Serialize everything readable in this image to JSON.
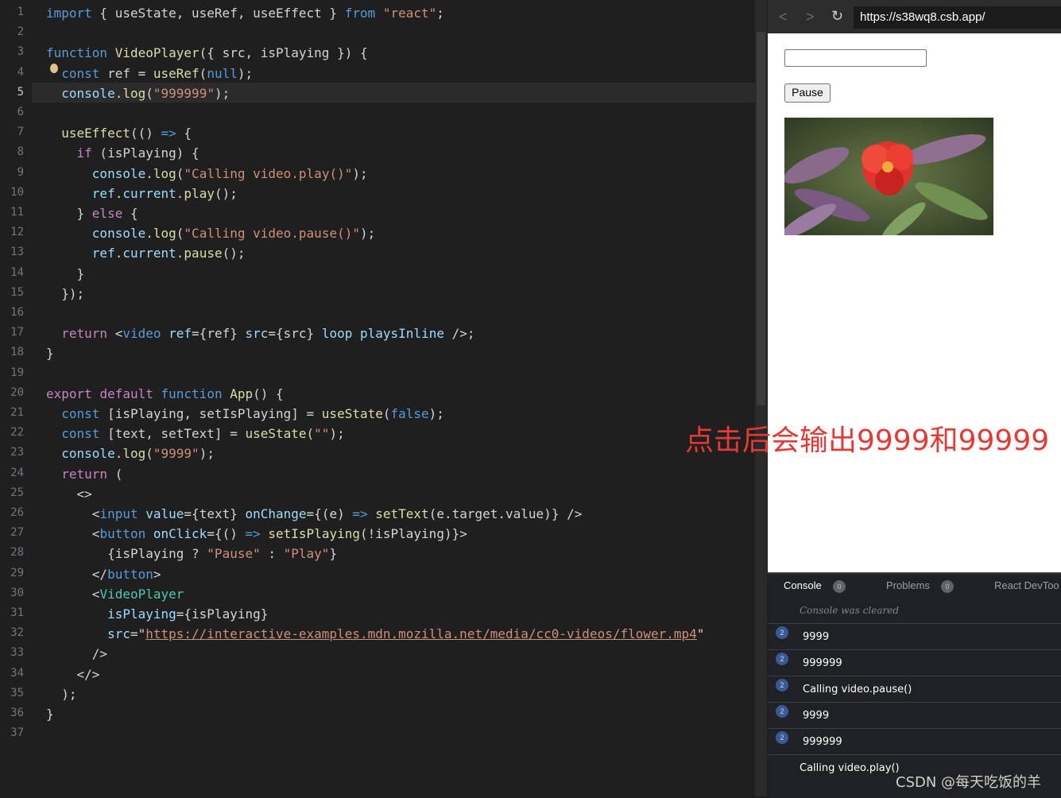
{
  "editor": {
    "line_numbers": [
      "1",
      "2",
      "3",
      "4",
      "5",
      "6",
      "7",
      "8",
      "9",
      "10",
      "11",
      "12",
      "13",
      "14",
      "15",
      "16",
      "17",
      "18",
      "19",
      "20",
      "21",
      "22",
      "23",
      "24",
      "25",
      "26",
      "27",
      "28",
      "29",
      "30",
      "31",
      "32",
      "33",
      "34",
      "35",
      "36",
      "37"
    ],
    "active_line": "5",
    "lines": [
      [
        [
          "kw",
          "import"
        ],
        [
          "pl",
          " { useState, useRef, useEffect } "
        ],
        [
          "kw",
          "from"
        ],
        [
          "pl",
          " "
        ],
        [
          "st",
          "\"react\""
        ],
        [
          "pl",
          ";"
        ]
      ],
      [],
      [
        [
          "kw",
          "function"
        ],
        [
          "pl",
          " "
        ],
        [
          "fn",
          "VideoPlayer"
        ],
        [
          "pl",
          "({ src, isPlaying }) {"
        ]
      ],
      [
        [
          "pl",
          "  "
        ],
        [
          "kw",
          "const"
        ],
        [
          "pl",
          " ref = "
        ],
        [
          "fn",
          "useRef"
        ],
        [
          "pl",
          "("
        ],
        [
          "kw",
          "null"
        ],
        [
          "pl",
          ");"
        ]
      ],
      [
        [
          "pl",
          "  "
        ],
        [
          "var",
          "console"
        ],
        [
          "pl",
          "."
        ],
        [
          "fn",
          "log"
        ],
        [
          "pl",
          "("
        ],
        [
          "st",
          "\"999999\""
        ],
        [
          "pl",
          ");"
        ]
      ],
      [],
      [
        [
          "pl",
          "  "
        ],
        [
          "fn",
          "useEffect"
        ],
        [
          "pl",
          "(() "
        ],
        [
          "kw",
          "=>"
        ],
        [
          "pl",
          " {"
        ]
      ],
      [
        [
          "pl",
          "    "
        ],
        [
          "ctl",
          "if"
        ],
        [
          "pl",
          " (isPlaying) {"
        ]
      ],
      [
        [
          "pl",
          "      "
        ],
        [
          "var",
          "console"
        ],
        [
          "pl",
          "."
        ],
        [
          "fn",
          "log"
        ],
        [
          "pl",
          "("
        ],
        [
          "st",
          "\"Calling video.play()\""
        ],
        [
          "pl",
          ");"
        ]
      ],
      [
        [
          "pl",
          "      "
        ],
        [
          "var",
          "ref"
        ],
        [
          "pl",
          "."
        ],
        [
          "var",
          "current"
        ],
        [
          "pl",
          "."
        ],
        [
          "fn",
          "play"
        ],
        [
          "pl",
          "();"
        ]
      ],
      [
        [
          "pl",
          "    } "
        ],
        [
          "ctl",
          "else"
        ],
        [
          "pl",
          " {"
        ]
      ],
      [
        [
          "pl",
          "      "
        ],
        [
          "var",
          "console"
        ],
        [
          "pl",
          "."
        ],
        [
          "fn",
          "log"
        ],
        [
          "pl",
          "("
        ],
        [
          "st",
          "\"Calling video.pause()\""
        ],
        [
          "pl",
          ");"
        ]
      ],
      [
        [
          "pl",
          "      "
        ],
        [
          "var",
          "ref"
        ],
        [
          "pl",
          "."
        ],
        [
          "var",
          "current"
        ],
        [
          "pl",
          "."
        ],
        [
          "fn",
          "pause"
        ],
        [
          "pl",
          "();"
        ]
      ],
      [
        [
          "pl",
          "    }"
        ]
      ],
      [
        [
          "pl",
          "  });"
        ]
      ],
      [],
      [
        [
          "pl",
          "  "
        ],
        [
          "ctl",
          "return"
        ],
        [
          "pl",
          " <"
        ],
        [
          "tag",
          "video"
        ],
        [
          "pl",
          " "
        ],
        [
          "attr",
          "ref"
        ],
        [
          "pl",
          "={ref} "
        ],
        [
          "attr",
          "src"
        ],
        [
          "pl",
          "={src} "
        ],
        [
          "attr",
          "loop"
        ],
        [
          "pl",
          " "
        ],
        [
          "attr",
          "playsInline"
        ],
        [
          "pl",
          " />;"
        ]
      ],
      [
        [
          "pl",
          "}"
        ]
      ],
      [],
      [
        [
          "ctl",
          "export"
        ],
        [
          "pl",
          " "
        ],
        [
          "ctl",
          "default"
        ],
        [
          "pl",
          " "
        ],
        [
          "kw",
          "function"
        ],
        [
          "pl",
          " "
        ],
        [
          "fn",
          "App"
        ],
        [
          "pl",
          "() {"
        ]
      ],
      [
        [
          "pl",
          "  "
        ],
        [
          "kw",
          "const"
        ],
        [
          "pl",
          " [isPlaying, setIsPlaying] = "
        ],
        [
          "fn",
          "useState"
        ],
        [
          "pl",
          "("
        ],
        [
          "kw",
          "false"
        ],
        [
          "pl",
          ");"
        ]
      ],
      [
        [
          "pl",
          "  "
        ],
        [
          "kw",
          "const"
        ],
        [
          "pl",
          " [text, setText] = "
        ],
        [
          "fn",
          "useState"
        ],
        [
          "pl",
          "("
        ],
        [
          "st",
          "\"\""
        ],
        [
          "pl",
          ");"
        ]
      ],
      [
        [
          "pl",
          "  "
        ],
        [
          "var",
          "console"
        ],
        [
          "pl",
          "."
        ],
        [
          "fn",
          "log"
        ],
        [
          "pl",
          "("
        ],
        [
          "st",
          "\"9999\""
        ],
        [
          "pl",
          ");"
        ]
      ],
      [
        [
          "pl",
          "  "
        ],
        [
          "ctl",
          "return"
        ],
        [
          "pl",
          " ("
        ]
      ],
      [
        [
          "pl",
          "    <>"
        ]
      ],
      [
        [
          "pl",
          "      <"
        ],
        [
          "tag",
          "input"
        ],
        [
          "pl",
          " "
        ],
        [
          "attr",
          "value"
        ],
        [
          "pl",
          "={text} "
        ],
        [
          "attr",
          "onChange"
        ],
        [
          "pl",
          "={(e) "
        ],
        [
          "kw",
          "=>"
        ],
        [
          "pl",
          " "
        ],
        [
          "fn",
          "setText"
        ],
        [
          "pl",
          "(e.target.value)} />"
        ]
      ],
      [
        [
          "pl",
          "      <"
        ],
        [
          "tag",
          "button"
        ],
        [
          "pl",
          " "
        ],
        [
          "attr",
          "onClick"
        ],
        [
          "pl",
          "={() "
        ],
        [
          "kw",
          "=>"
        ],
        [
          "pl",
          " "
        ],
        [
          "fn",
          "setIsPlaying"
        ],
        [
          "pl",
          "(!isPlaying)}>"
        ]
      ],
      [
        [
          "pl",
          "        {isPlaying ? "
        ],
        [
          "st",
          "\"Pause\""
        ],
        [
          "pl",
          " : "
        ],
        [
          "st",
          "\"Play\""
        ],
        [
          "pl",
          "}"
        ]
      ],
      [
        [
          "pl",
          "      </"
        ],
        [
          "tag",
          "button"
        ],
        [
          "pl",
          ">"
        ]
      ],
      [
        [
          "pl",
          "      <"
        ],
        [
          "cls",
          "VideoPlayer"
        ]
      ],
      [
        [
          "pl",
          "        "
        ],
        [
          "attr",
          "isPlaying"
        ],
        [
          "pl",
          "={isPlaying}"
        ]
      ],
      [
        [
          "pl",
          "        "
        ],
        [
          "attr",
          "src"
        ],
        [
          "pl",
          "=\""
        ],
        [
          "url",
          "https://interactive-examples.mdn.mozilla.net/media/cc0-videos/flower.mp4"
        ],
        [
          "pl",
          "\""
        ]
      ],
      [
        [
          "pl",
          "      />"
        ]
      ],
      [
        [
          "pl",
          "    </>"
        ]
      ],
      [
        [
          "pl",
          "  );"
        ]
      ],
      [
        [
          "pl",
          "}"
        ]
      ],
      []
    ]
  },
  "browser": {
    "url": "https://s38wq8.csb.app/",
    "back_icon": "<",
    "forward_icon": ">",
    "reload_icon": "↻",
    "input_value": "",
    "button_label": "Pause"
  },
  "console": {
    "tabs": [
      {
        "label": "Console",
        "count": "0"
      },
      {
        "label": "Problems",
        "count": "0"
      },
      {
        "label": "React DevToo",
        "count": ""
      }
    ],
    "cleared_text": "Console was cleared",
    "logs": [
      {
        "badge": "2",
        "text": "9999"
      },
      {
        "badge": "2",
        "text": "999999"
      },
      {
        "badge": "2",
        "text": "Calling video.pause()"
      },
      {
        "badge": "2",
        "text": "9999"
      },
      {
        "badge": "2",
        "text": "999999"
      },
      {
        "badge": "",
        "text": "Calling video.play()"
      }
    ]
  },
  "annotation": "点击后会输出9999和99999",
  "watermark": "CSDN @每天吃饭的羊",
  "colors": {
    "keyword": "#569cd6",
    "function": "#dcdcaa",
    "string": "#ce9178",
    "annotation_red": "#e53935"
  }
}
